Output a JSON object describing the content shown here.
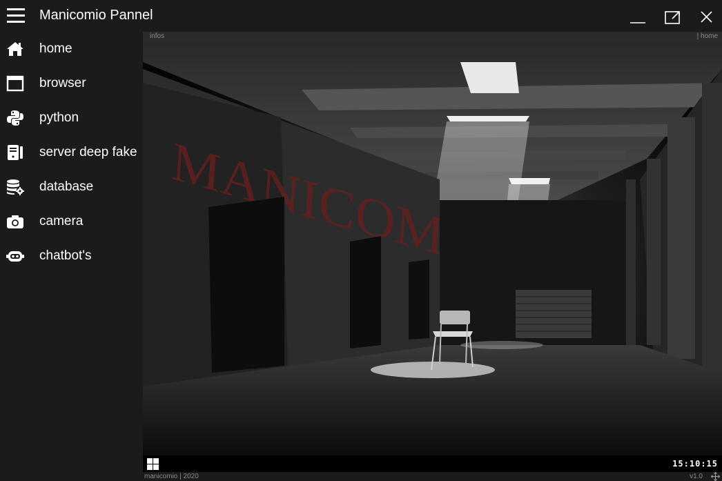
{
  "window": {
    "title": "Manicomio Pannel",
    "controls": [
      "minimize-icon",
      "maximize-icon",
      "close-icon"
    ]
  },
  "sidebar": {
    "menu_icon": "hamburger-icon",
    "items": [
      {
        "label": "home",
        "icon": "home-icon"
      },
      {
        "label": "browser",
        "icon": "browser-window-icon"
      },
      {
        "label": "python",
        "icon": "python-icon"
      },
      {
        "label": "server deep fake",
        "icon": "server-icon"
      },
      {
        "label": "database",
        "icon": "database-gear-icon"
      },
      {
        "label": "camera",
        "icon": "camera-icon"
      },
      {
        "label": "chatbot's",
        "icon": "robot-icon"
      }
    ]
  },
  "panel": {
    "infobar_left": "infos",
    "infobar_right": "| home",
    "scene_text": "MANICOMIO",
    "taskbar": {
      "start_icon": "windows-logo-icon",
      "clock": "15:10:15"
    },
    "footer_left": "manicomio | 2020",
    "footer_right": "v1.0",
    "resize_icon": "move-arrows-icon"
  },
  "colors": {
    "background": "#1b1b1b",
    "panel_bar": "#2b2b2b",
    "text": "#ffffff",
    "muted_text": "#8a8a8a"
  }
}
